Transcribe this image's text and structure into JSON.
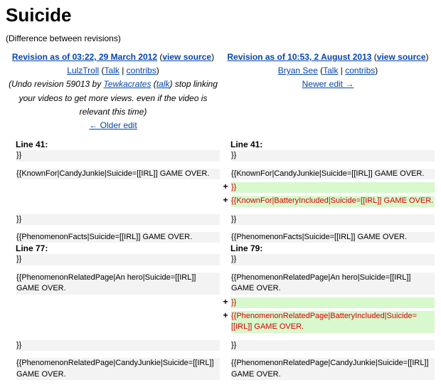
{
  "title": "Suicide",
  "subtitle": "(Difference between revisions)",
  "left": {
    "rev_label": "Revision as of 03:22, 29 March 2012",
    "view_source": "view source",
    "user": "LulzTroll",
    "talk": "Talk",
    "contribs": "contribs",
    "summary": "(Undo revision 59013 by Tewkacrates (talk) stop linking your videos to get more views. even if the video is relevant this time)",
    "summary_prefix": "(Undo revision 59013 by ",
    "summary_user": "Tewkacrates",
    "summary_mid": " (",
    "summary_talk": "talk",
    "summary_suffix": ") stop linking your videos to get more views. even if the video is relevant this time)",
    "nav": "← Older edit",
    "line1": "Line 41:",
    "line2": "Line 77:"
  },
  "right": {
    "rev_label": "Revision as of 10:53, 2 August 2013",
    "view_source": "view source",
    "user": "Bryan See",
    "talk": "Talk",
    "contribs": "contribs",
    "nav": "Newer edit →",
    "line1": "Line 41:",
    "line2": "Line 79:"
  },
  "rows": [
    {
      "type": "ctx",
      "l": "}}",
      "r": "}}"
    },
    {
      "type": "ctx",
      "l": "{{KnownFor|CandyJunkie|Suicide=[[IRL]] GAME OVER.",
      "r": "{{KnownFor|CandyJunkie|Suicide=[[IRL]] GAME OVER."
    },
    {
      "type": "add",
      "r": "}}"
    },
    {
      "type": "add",
      "r": "{{KnownFor|BatteryIncluded|Suicide=[[IRL]] GAME OVER."
    },
    {
      "type": "ctx",
      "l": "}}",
      "r": "}}"
    },
    {
      "type": "ctx",
      "l": "{{PhenomenonFacts|Suicide=[[IRL]] GAME OVER.",
      "r": "{{PhenomenonFacts|Suicide=[[IRL]] GAME OVER."
    },
    {
      "type": "header2"
    },
    {
      "type": "ctx",
      "l": "}}",
      "r": "}}"
    },
    {
      "type": "ctx",
      "l": "{{PhenomenonRelatedPage|An hero|Suicide=[[IRL]] GAME OVER.",
      "r": "{{PhenomenonRelatedPage|An hero|Suicide=[[IRL]] GAME OVER."
    },
    {
      "type": "add",
      "r": "}}"
    },
    {
      "type": "add",
      "r": "{{PhenomenonRelatedPage|BatteryIncluded|Suicide=[[IRL]] GAME OVER."
    },
    {
      "type": "ctx",
      "l": "}}",
      "r": "}}"
    },
    {
      "type": "ctx",
      "l": "{{PhenomenonRelatedPage|CandyJunkie|Suicide=[[IRL]] GAME OVER.",
      "r": "{{PhenomenonRelatedPage|CandyJunkie|Suicide=[[IRL]] GAME OVER."
    }
  ],
  "plus": "+"
}
